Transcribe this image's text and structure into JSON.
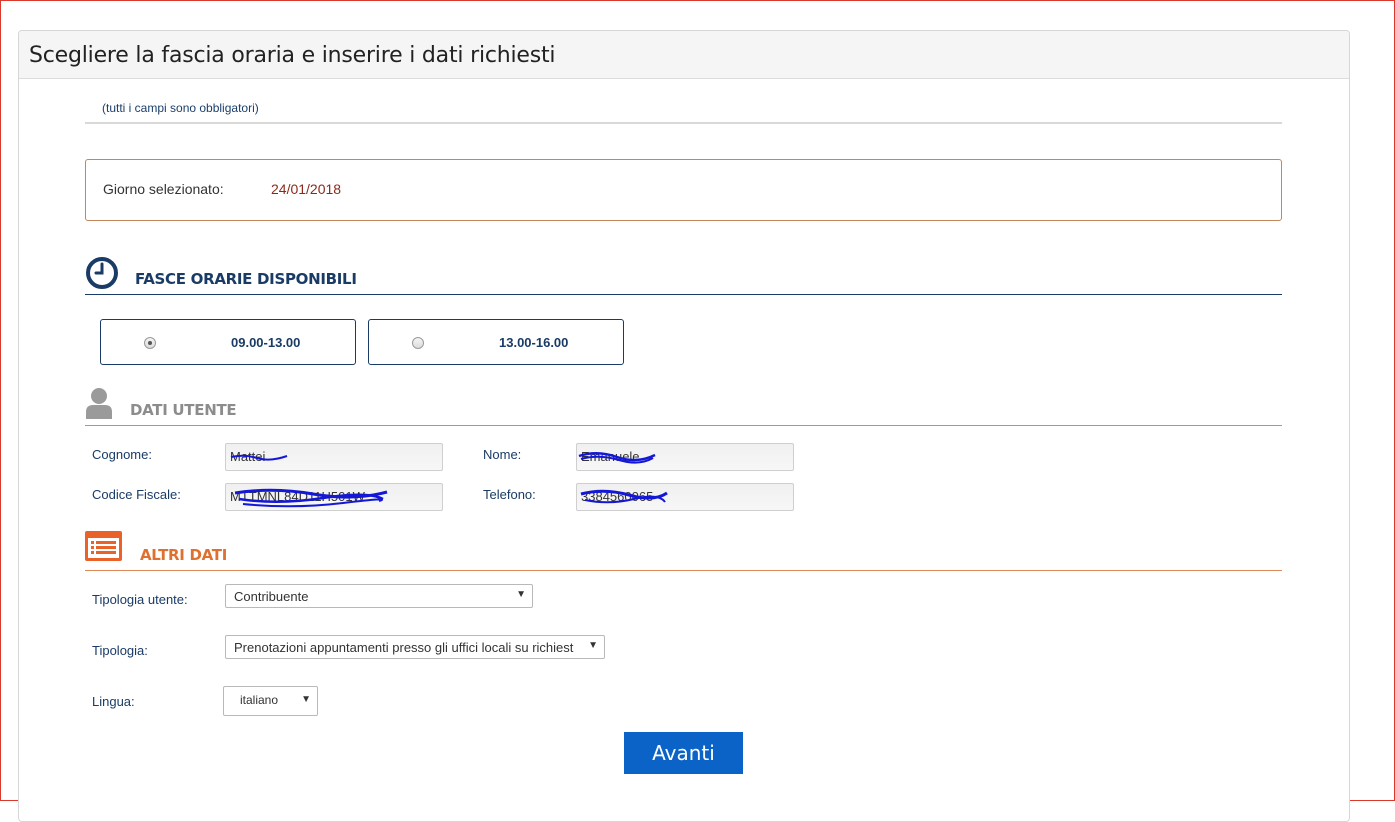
{
  "header": {
    "title": "Scegliere la fascia oraria e inserire i dati richiesti"
  },
  "note": "(tutti i campi sono obbligatori)",
  "selected_day": {
    "label": "Giorno selezionato:",
    "value": "24/01/2018"
  },
  "time_slots": {
    "title": "FASCE ORARIE DISPONIBILI",
    "icon": "clock-icon",
    "options": [
      {
        "label": "09.00-13.00",
        "checked": true
      },
      {
        "label": "13.00-16.00",
        "checked": false
      }
    ]
  },
  "user_data": {
    "title": "DATI UTENTE",
    "icon": "user-icon",
    "cognome_label": "Cognome:",
    "cognome_value": "Mattei",
    "nome_label": "Nome:",
    "nome_value": "Emanuele",
    "cf_label": "Codice Fiscale:",
    "cf_value": "MTTMNL84D11H501W",
    "telefono_label": "Telefono:",
    "telefono_value": "3384560065"
  },
  "other_data": {
    "title": "ALTRI DATI",
    "icon": "list-icon",
    "tipologia_utente_label": "Tipologia utente:",
    "tipologia_utente_value": "Contribuente",
    "tipologia_label": "Tipologia:",
    "tipologia_value": "Prenotazioni appuntamenti presso gli uffici locali su richiest",
    "lingua_label": "Lingua:",
    "lingua_value": "italiano"
  },
  "actions": {
    "next_label": "Avanti"
  },
  "colors": {
    "navy": "#1a3b66",
    "orange": "#e07030",
    "gray": "#8c8c8c",
    "button": "#0b63c8",
    "date": "#8b2a1a"
  }
}
